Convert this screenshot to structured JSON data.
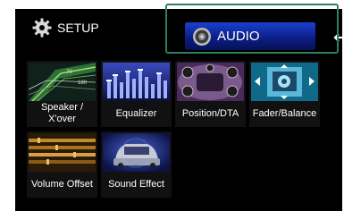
{
  "header": {
    "setup_title": "SETUP",
    "audio_title": "AUDIO",
    "back_icon": "back-arrow-icon"
  },
  "tiles": [
    {
      "label": "Speaker /\nX'over",
      "icon": "speaker-xover-thumbnail"
    },
    {
      "label": "Equalizer",
      "icon": "equalizer-thumbnail"
    },
    {
      "label": "Position/DTA",
      "icon": "position-dta-thumbnail"
    },
    {
      "label": "Fader/Balance",
      "icon": "fader-balance-thumbnail"
    },
    {
      "label": "Volume Offset",
      "icon": "volume-offset-thumbnail"
    },
    {
      "label": "Sound Effect",
      "icon": "sound-effect-thumbnail"
    }
  ],
  "colors": {
    "background": "#000000",
    "audio_bar": "#1a3fd0",
    "highlight_border": "#2f7f5a",
    "text": "#ffffff"
  }
}
